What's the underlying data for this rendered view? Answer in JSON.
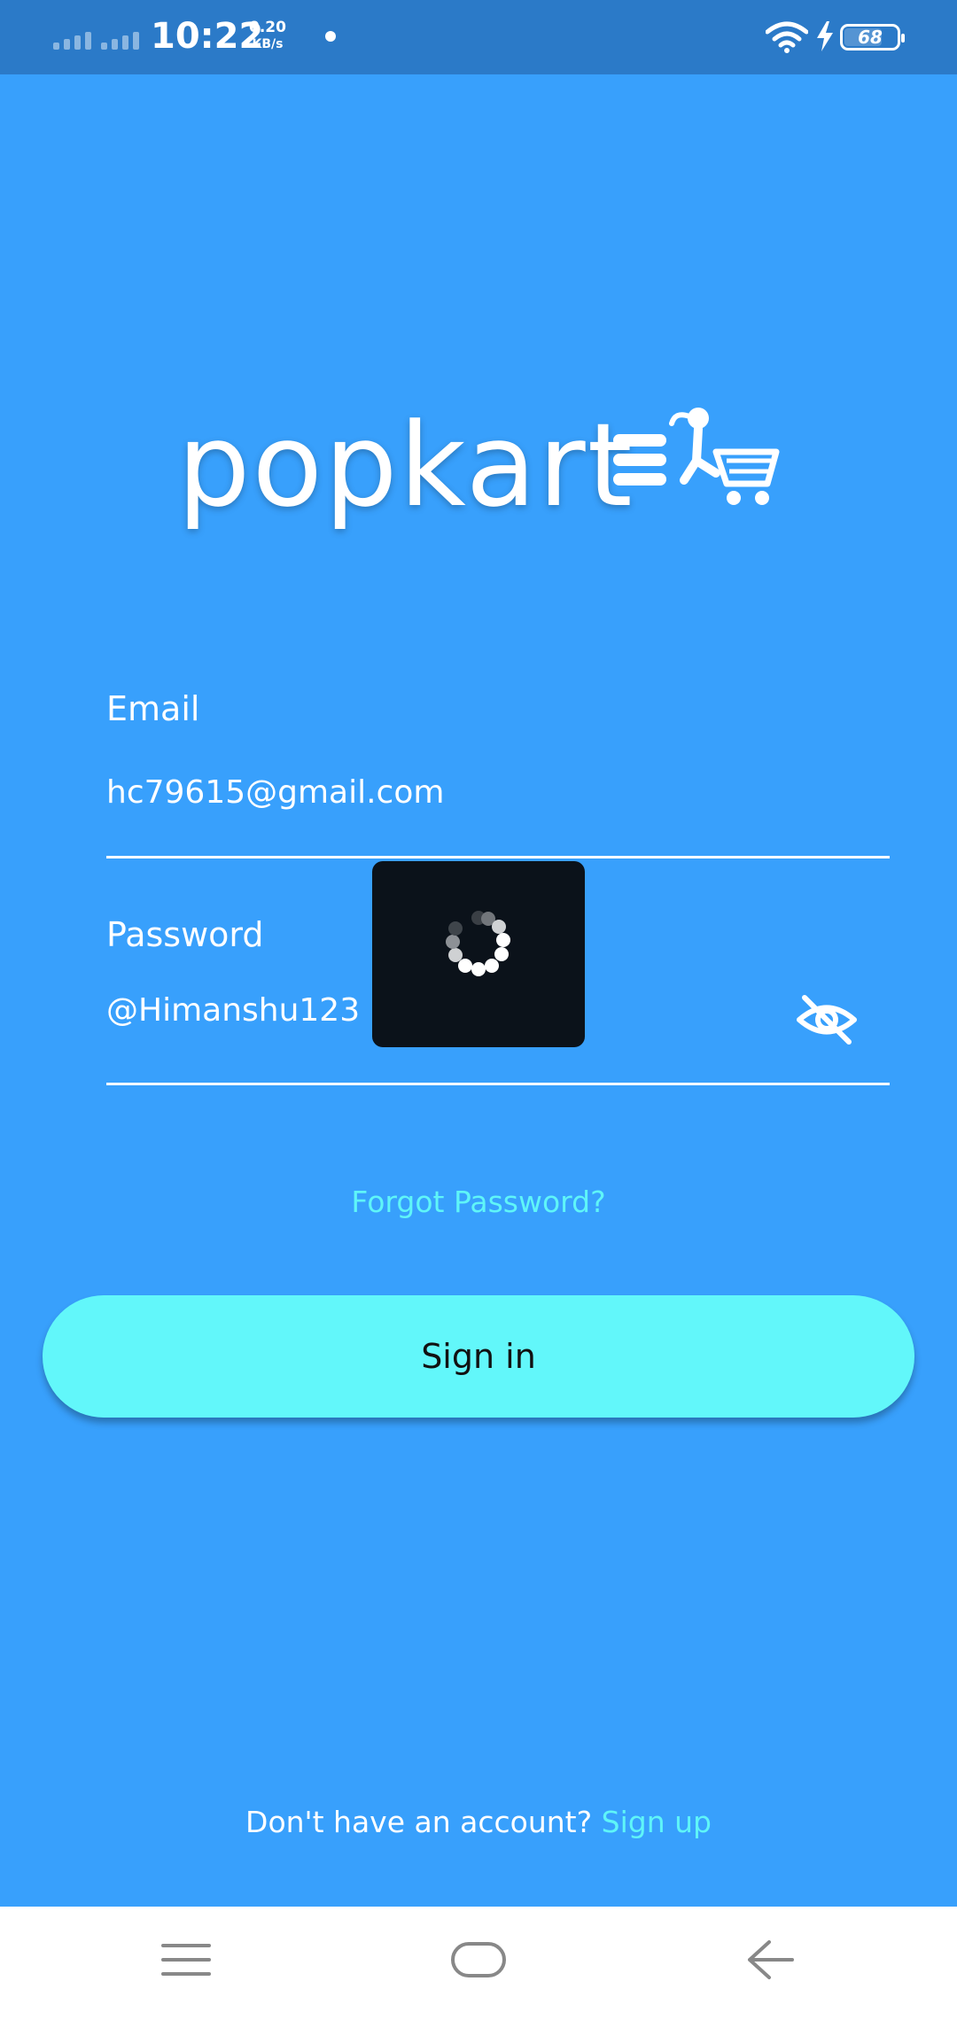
{
  "status_bar": {
    "time": "10:22",
    "net_speed_value": "0.20",
    "net_speed_unit": "KB/s",
    "battery": "68",
    "icons": [
      "signal-icon",
      "signal-icon",
      "notification-dot-icon",
      "wifi-icon",
      "charging-icon",
      "battery-icon"
    ]
  },
  "logo": {
    "text": "popkart"
  },
  "form": {
    "email_label": "Email",
    "email_value": "hc79615@gmail.com",
    "password_label": "Password",
    "password_value": "@Himanshu123",
    "visibility_icon": "eye-off-icon"
  },
  "loader": {
    "icon": "loading-spinner-icon"
  },
  "forgot_password": "Forgot Password?",
  "sign_in_label": "Sign in",
  "signup": {
    "prompt": "Don't have an account?",
    "link": "Sign up"
  },
  "nav": {
    "icons": [
      "menu-icon",
      "home-icon",
      "back-icon"
    ]
  },
  "colors": {
    "background": "#38a0fc",
    "status_bar": "#2b7ac8",
    "accent": "#5ff5f8",
    "button": "#62f7fa"
  }
}
